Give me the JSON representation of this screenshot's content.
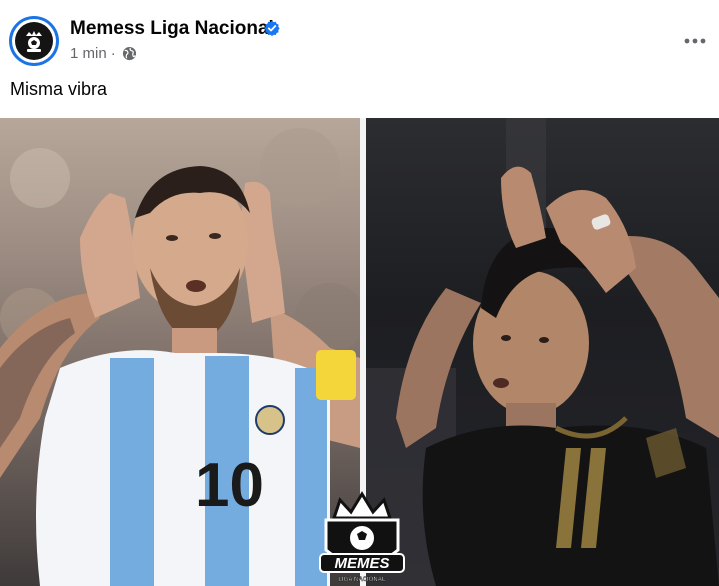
{
  "post": {
    "page_name": "Memess Liga Nacional",
    "timestamp": "1 min",
    "separator": "·",
    "privacy_icon": "globe-icon",
    "verified_icon": "verified-badge-icon",
    "more_icon": "more-options-icon",
    "caption": "Misma vibra"
  },
  "media": {
    "left_jersey_number": "10",
    "logo_text": "MEMES",
    "logo_subtext": "LIGA NACIONAL"
  },
  "colors": {
    "verified_blue": "#1877f2",
    "secondary_text": "#65676b",
    "avatar_ring": "#1b74e4"
  }
}
